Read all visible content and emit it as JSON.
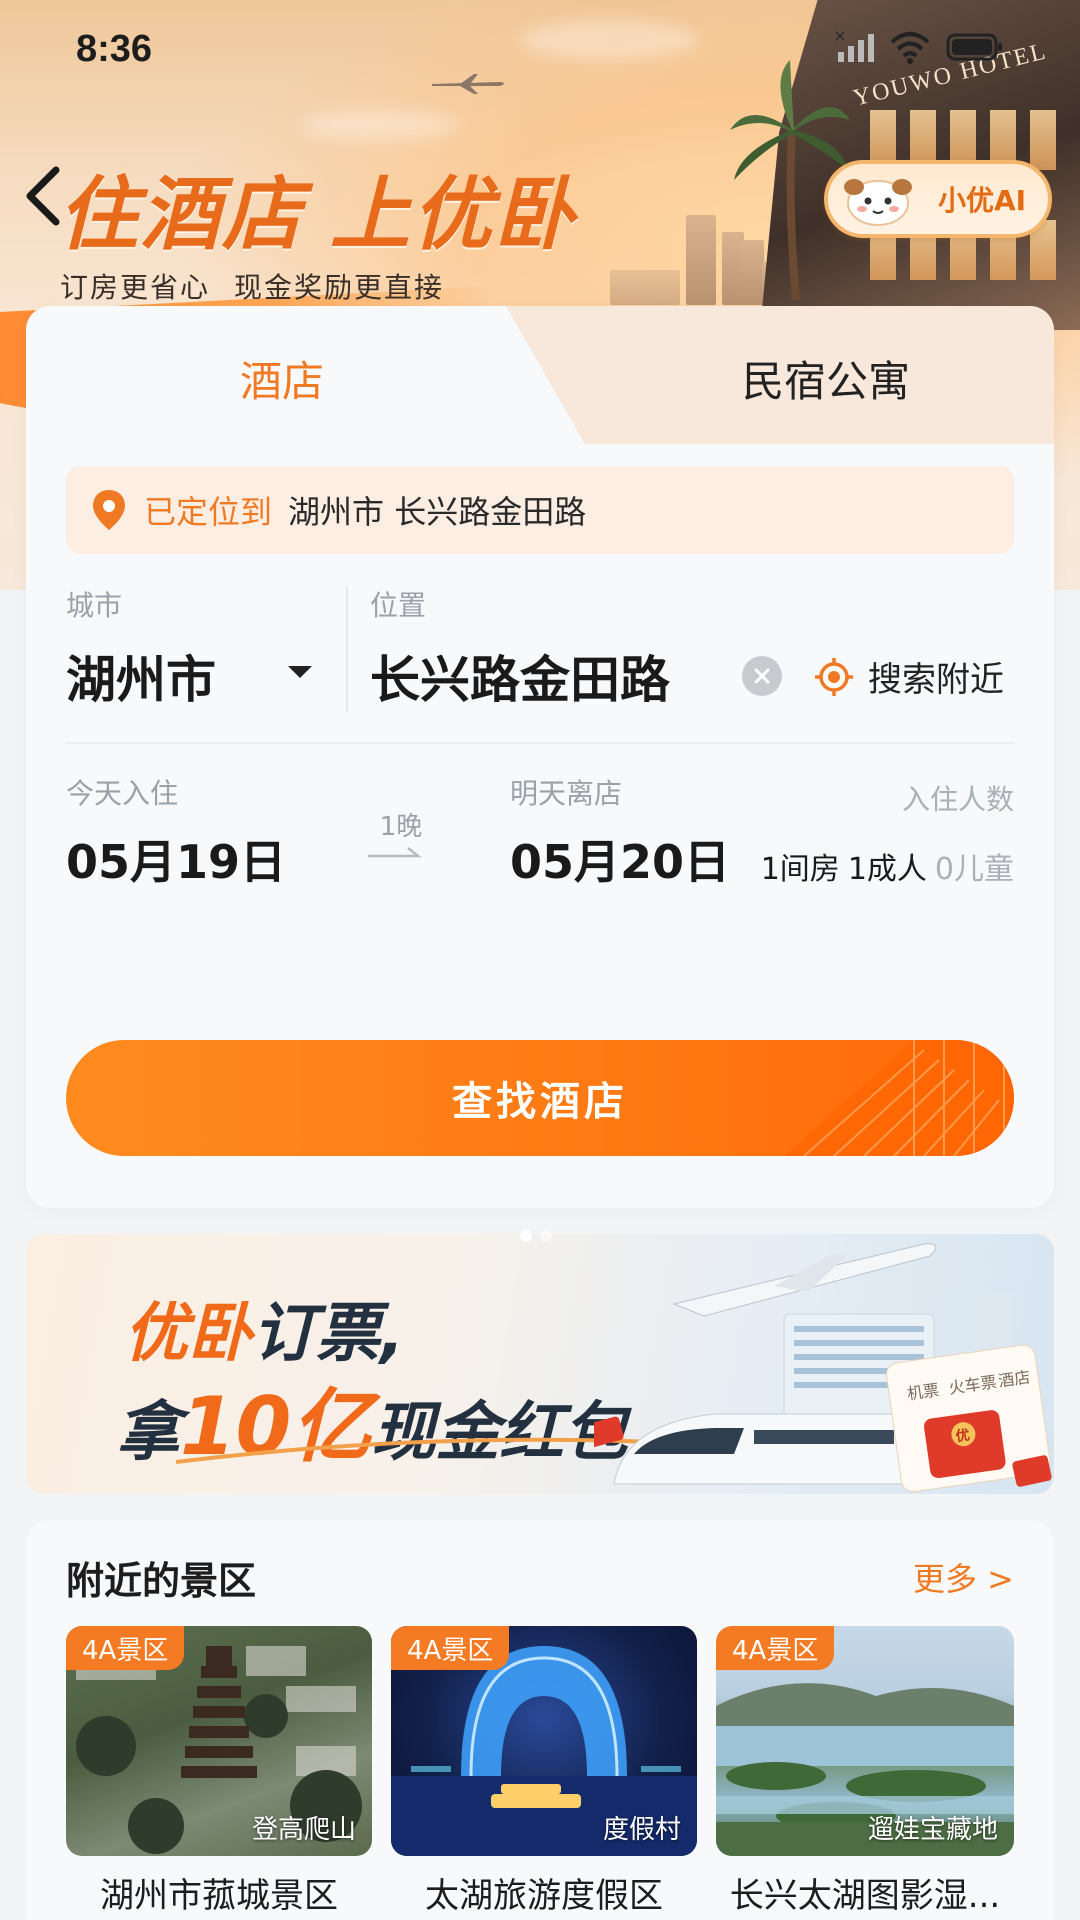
{
  "status_bar": {
    "time": "8:36"
  },
  "hero": {
    "slogan_part1": "住酒店",
    "slogan_part2": "上优卧",
    "sub_part1": "订房更省心",
    "sub_part2": "现金奖励更直接",
    "hotel_sign": "YOUWO HOTEL",
    "ai_button_label": "小优AI"
  },
  "tabs": [
    {
      "label": "酒店",
      "active": true
    },
    {
      "label": "民宿公寓",
      "active": false
    }
  ],
  "location_banner": {
    "prefix": "已定位到",
    "address": "湖州市 长兴路金田路"
  },
  "search_form": {
    "city_label": "城市",
    "city_value": "湖州市",
    "position_label": "位置",
    "position_value": "长兴路金田路",
    "nearby_label": "搜索附近",
    "checkin_label": "今天入住",
    "checkin_date": "05月19日",
    "nights": "1晚",
    "checkout_label": "明天离店",
    "checkout_date": "05月20日",
    "guests_label": "入住人数",
    "rooms": "1间房",
    "adults": "1成人",
    "children": "0儿童",
    "search_button": "查找酒店"
  },
  "promo": {
    "line1_orange": "优卧",
    "line1_dark": "订票,",
    "line2_a": "拿",
    "line2_big": "10亿",
    "line2_b": "现金红包",
    "card_labels": [
      "机票",
      "火车票",
      "酒店"
    ],
    "stamp": "优"
  },
  "nearby_section": {
    "title": "附近的景区",
    "more": "更多 >",
    "items": [
      {
        "badge": "4A景区",
        "tag": "登高爬山",
        "name": "湖州市菰城景区"
      },
      {
        "badge": "4A景区",
        "tag": "度假村",
        "name": "太湖旅游度假区"
      },
      {
        "badge": "4A景区",
        "tag": "遛娃宝藏地",
        "name": "长兴太湖图影湿..."
      }
    ]
  },
  "colors": {
    "accent": "#f07a23",
    "button": "#ff7a12",
    "text": "#1a1a1a",
    "muted": "#9aa1a8"
  }
}
